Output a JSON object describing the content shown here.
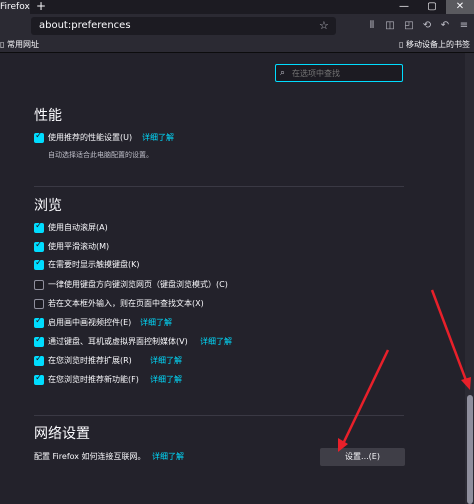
{
  "browser": {
    "tab_title": "Firefox",
    "new_tab": "+",
    "window_controls": [
      "—",
      "▢",
      "✕"
    ],
    "url": "about:preferences",
    "toolbar_icons": [
      "library-icon",
      "sidebar-icon",
      "screenshot-icon",
      "sync-icon",
      "undo-icon",
      "menu-icon"
    ],
    "bookmarks_left": "常用网址",
    "bookmarks_right": "移动设备上的书签"
  },
  "search": {
    "placeholder": "在选项中查找"
  },
  "performance": {
    "heading": "性能",
    "use_recommended": {
      "label": "使用推荐的性能设置(U)",
      "link": "详细了解",
      "checked": true
    },
    "description": "自动选择适合此电脑配置的设置。"
  },
  "browsing": {
    "heading": "浏览",
    "options": [
      {
        "label": "使用自动滚屏(A)",
        "checked": true
      },
      {
        "label": "使用平滑滚动(M)",
        "checked": true
      },
      {
        "label": "在需要时显示触摸键盘(K)",
        "checked": true
      },
      {
        "label": "一律使用键盘方向键浏览网页（键盘浏览模式）(C)",
        "checked": false
      },
      {
        "label": "若在文本框外输入，则在页面中查找文本(X)",
        "checked": false
      },
      {
        "label": "启用画中画视频控件(E)",
        "checked": true,
        "link": "详细了解"
      },
      {
        "label": "通过键盘、耳机或虚拟界面控制媒体(V)",
        "checked": true,
        "link": "详细了解"
      },
      {
        "label": "在您浏览时推荐扩展(R)",
        "checked": true,
        "link": "详细了解"
      },
      {
        "label": "在您浏览时推荐新功能(F)",
        "checked": true,
        "link": "详细了解"
      }
    ]
  },
  "network": {
    "heading": "网络设置",
    "description": "配置 Firefox 如何连接互联网。",
    "link": "详细了解",
    "settings_button": "设置...(E)"
  },
  "colors": {
    "accent": "#00ddff",
    "annotation_arrow": "#e8202a"
  }
}
